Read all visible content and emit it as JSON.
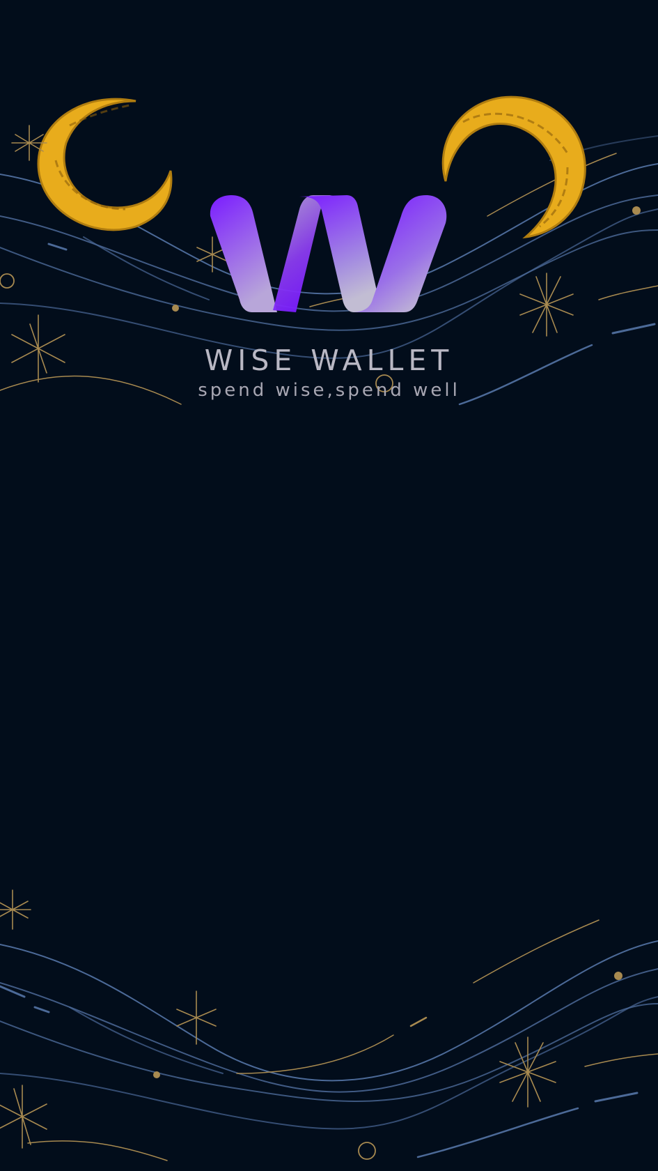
{
  "splash": {
    "app_name": "WISE WALLET",
    "tagline": "spend wise,spend well"
  },
  "colors": {
    "background": "#020d1b",
    "accent_purple": "#7a1cff",
    "accent_lilac": "#b8a6d9",
    "moon_gold": "#e8ac1c",
    "wave_blue": "#4c6a98",
    "star_gold": "#a88a50",
    "text_light": "#b9b8c4"
  },
  "icons": {
    "logo": "w-ribbon-logo",
    "decorations": [
      "crescent-moon-icon",
      "sparkle-star-icon",
      "wave-lines"
    ]
  }
}
